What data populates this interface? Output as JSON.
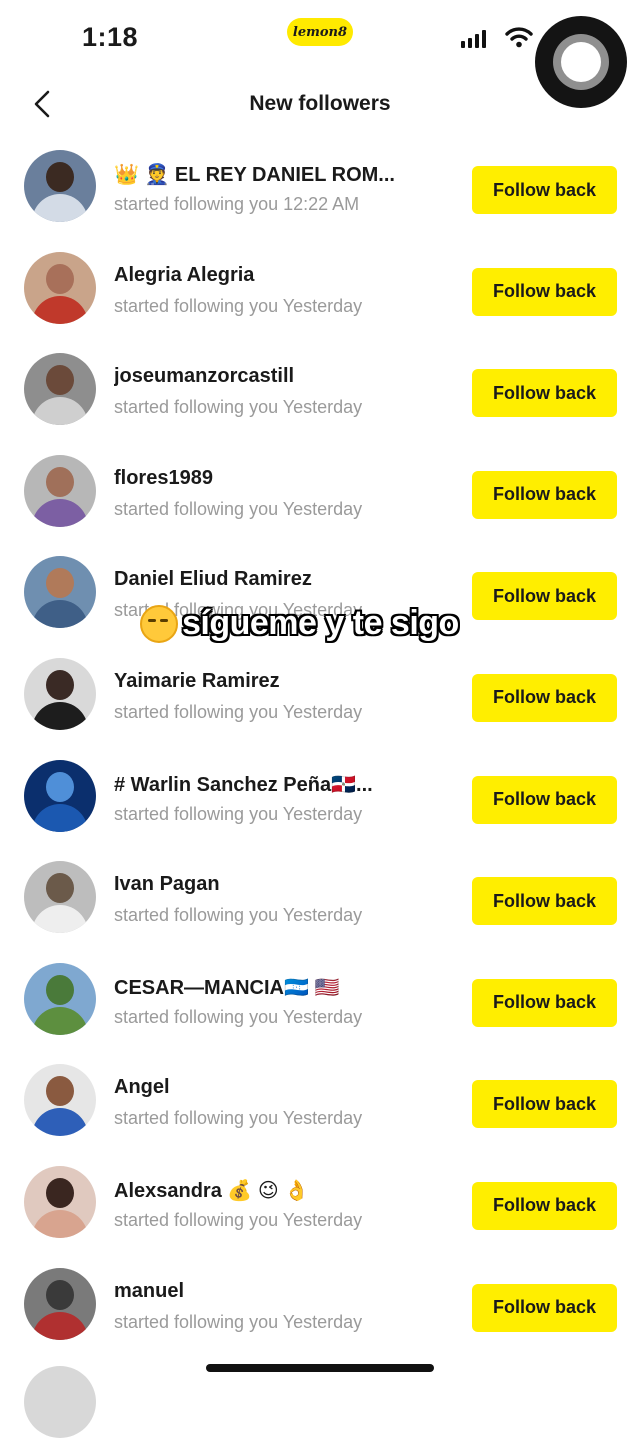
{
  "status_bar": {
    "time": "1:18",
    "app_badge": "lemon8"
  },
  "header": {
    "title": "New followers"
  },
  "followers": [
    {
      "name": "👑 👮 EL REY DANIEL ROM...",
      "subtitle": "started following you 12:22 AM",
      "button": "Follow back",
      "avatar_colors": [
        "#6a7f9c",
        "#3b2a22",
        "#d3dbe6"
      ]
    },
    {
      "name": "Alegria Alegria",
      "subtitle": "started following you Yesterday",
      "button": "Follow back",
      "avatar_colors": [
        "#c9a48a",
        "#a8705a",
        "#c0392b"
      ]
    },
    {
      "name": "joseumanzorcastill",
      "subtitle": "started following you Yesterday",
      "button": "Follow back",
      "avatar_colors": [
        "#8e8e8e",
        "#6b4a3a",
        "#cfcfcf"
      ]
    },
    {
      "name": "flores1989",
      "subtitle": "started following you Yesterday",
      "button": "Follow back",
      "avatar_colors": [
        "#b7b7b7",
        "#a0705a",
        "#7c5fa3"
      ]
    },
    {
      "name": "Daniel Eliud Ramirez",
      "subtitle": "started following you Yesterday",
      "button": "Follow back",
      "avatar_colors": [
        "#6f8fb0",
        "#b07a5a",
        "#3f5f87"
      ]
    },
    {
      "name": "Yaimarie Ramirez",
      "subtitle": "started following you Yesterday",
      "button": "Follow back",
      "avatar_colors": [
        "#d9d9d9",
        "#3a2a25",
        "#1d1d1d"
      ]
    },
    {
      "name": "# Warlin Sanchez Peña🇩🇴...",
      "subtitle": "started following you Yesterday",
      "button": "Follow back",
      "avatar_colors": [
        "#0b2f6d",
        "#4f8fd8",
        "#1b58b0"
      ]
    },
    {
      "name": "Ivan Pagan",
      "subtitle": "started following you Yesterday",
      "button": "Follow back",
      "avatar_colors": [
        "#bdbdbd",
        "#6b5a4a",
        "#eeeeee"
      ]
    },
    {
      "name": "CESAR—MANCIA🇭🇳 🇺🇸",
      "subtitle": "started following you Yesterday",
      "button": "Follow back",
      "avatar_colors": [
        "#7fa8d0",
        "#4a7a3a",
        "#5d8f3f"
      ]
    },
    {
      "name": "Angel",
      "subtitle": "started following you Yesterday",
      "button": "Follow back",
      "avatar_colors": [
        "#e6e6e6",
        "#8a5a40",
        "#2e5fb8"
      ]
    },
    {
      "name": "Alexsandra 💰 😉 👌",
      "subtitle": "started following you Yesterday",
      "button": "Follow back",
      "avatar_colors": [
        "#e0c9bf",
        "#3a2620",
        "#d8a48f"
      ]
    },
    {
      "name": "manuel",
      "subtitle": "started following you Yesterday",
      "button": "Follow back",
      "avatar_colors": [
        "#7a7a7a",
        "#3a3a3a",
        "#b03030"
      ]
    }
  ],
  "overlay": {
    "emoji": "😔",
    "text": "sígueme y te sigo"
  },
  "colors": {
    "accent_yellow": "#ffee00",
    "subtitle_gray": "#9a9a9a"
  },
  "icons": {
    "back": "chevron-left-icon",
    "signal": "cellular-signal-icon",
    "wifi": "wifi-icon",
    "assistive_touch": "assistive-touch-icon"
  }
}
